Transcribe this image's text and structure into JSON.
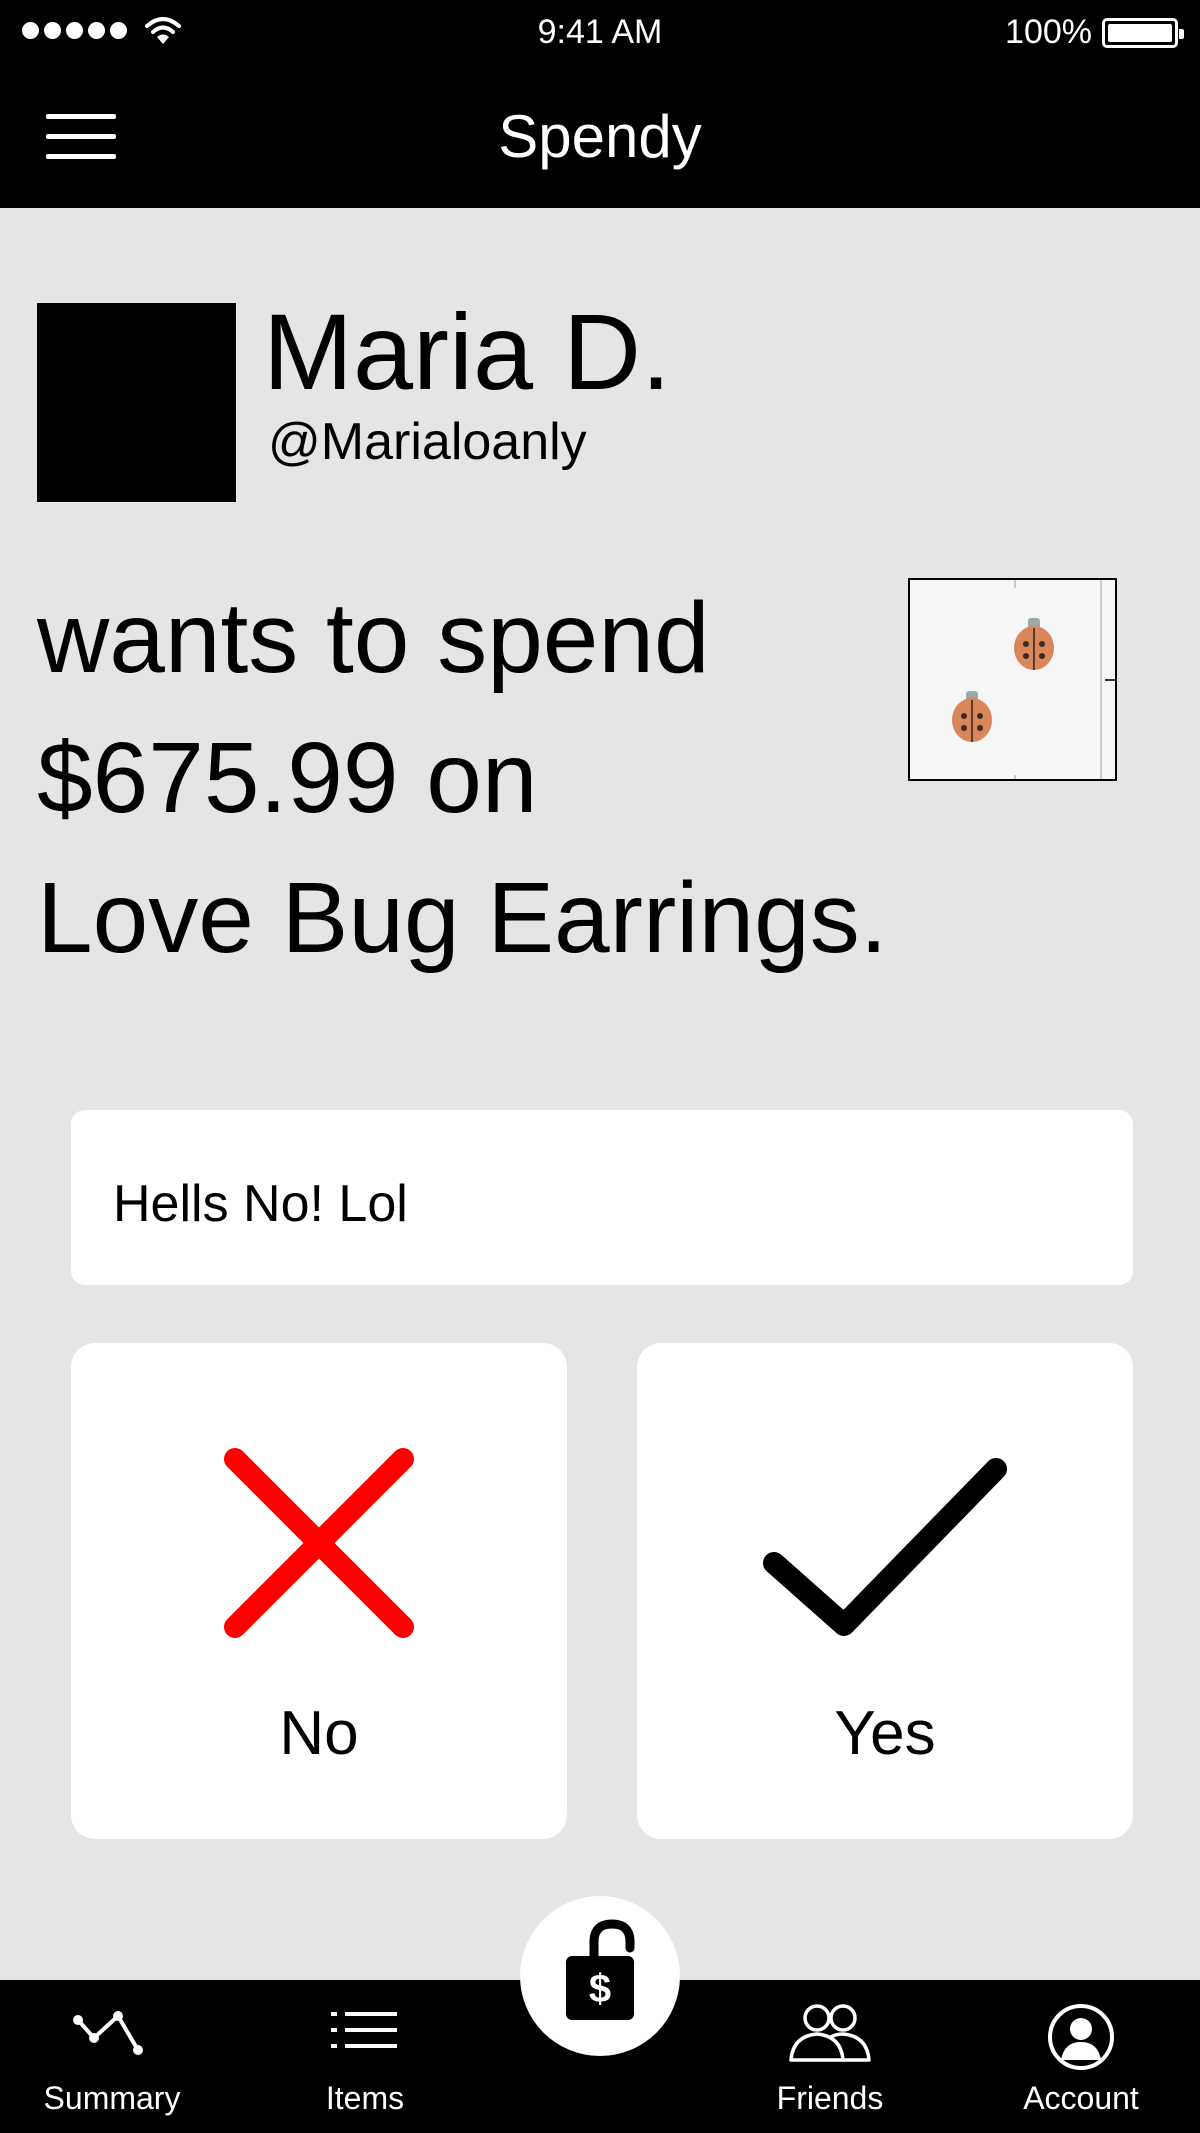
{
  "status_bar": {
    "time": "9:41 AM",
    "battery": "100%"
  },
  "header": {
    "title": "Spendy",
    "menu_icon": "hamburger-menu-icon"
  },
  "user": {
    "name": "Maria D.",
    "handle": "@Marialoanly"
  },
  "message": {
    "line1": "wants to spend",
    "line2": "$675.99 on",
    "line3": "Love Bug Earrings."
  },
  "comment": {
    "text": "Hells No! Lol"
  },
  "vote": {
    "no_label": "No",
    "yes_label": "Yes",
    "no_icon": "x-icon",
    "yes_icon": "checkmark-icon",
    "no_color": "#ff0000",
    "yes_color": "#000000"
  },
  "tabs": [
    {
      "label": "Summary",
      "icon": "chart-line-icon"
    },
    {
      "label": "Items",
      "icon": "list-icon"
    },
    {
      "label": "Friends",
      "icon": "friends-icon"
    },
    {
      "label": "Account",
      "icon": "account-icon"
    }
  ],
  "center_button_icon": "lock-dollar-icon",
  "colors": {
    "background": "#e5e5e5",
    "bar": "#000000",
    "card": "#ffffff",
    "accent_red": "#ff0000"
  }
}
